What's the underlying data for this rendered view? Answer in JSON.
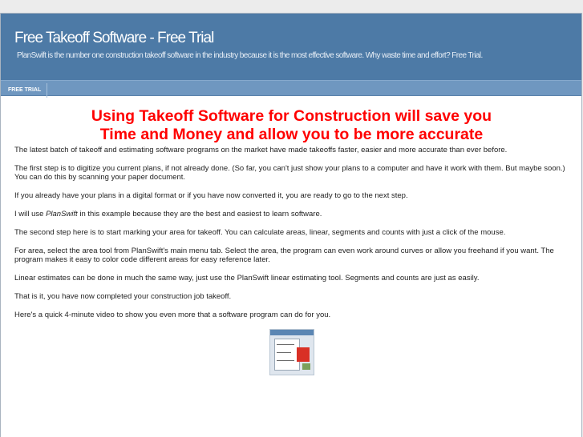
{
  "header": {
    "title": "Free Takeoff Software - Free Trial",
    "tagline": "PlanSwift is the number one construction takeoff software in the industry because it is the most effective software. Why waste time and effort? Free Trial."
  },
  "nav": {
    "tabs": [
      {
        "label": "FREE TRIAL"
      }
    ]
  },
  "article": {
    "headline_line1": "Using Takeoff Software for Construction will save you",
    "headline_line2": "Time and Money and allow you to be more accurate",
    "paragraphs": [
      "The latest batch of takeoff and estimating software programs on the market have made takeoffs faster, easier and more accurate than ever before.",
      "The first step is to digitize you current plans, if not already done. (So far, you can't just show your plans to a computer and have it work with them. But maybe soon.) You can do this by scanning your paper document.",
      "If you already have your plans in a digital format or if you have now converted it, you are ready to go to the next step."
    ],
    "planswift_para": {
      "before": "I will use ",
      "emphasis": "PlanSwift",
      "after": " in this example because they are the best and easiest to learn software."
    },
    "paragraphs2": [
      "The second step here is to start marking your area for takeoff. You can calculate areas, linear, segments and counts with just a click of the mouse.",
      "For area, select the area tool from PlanSwift's main menu tab. Select the area, the program can even work around curves or allow you freehand if you want. The program makes it easy to color code different areas for easy reference later.",
      "Linear estimates can be done in much the same way, just use the PlanSwift linear estimating tool. Segments and counts are just as easily.",
      "That is it, you have now completed your construction job takeoff.",
      "Here's a quick 4-minute video to show you even more that a software program can do for you."
    ]
  }
}
